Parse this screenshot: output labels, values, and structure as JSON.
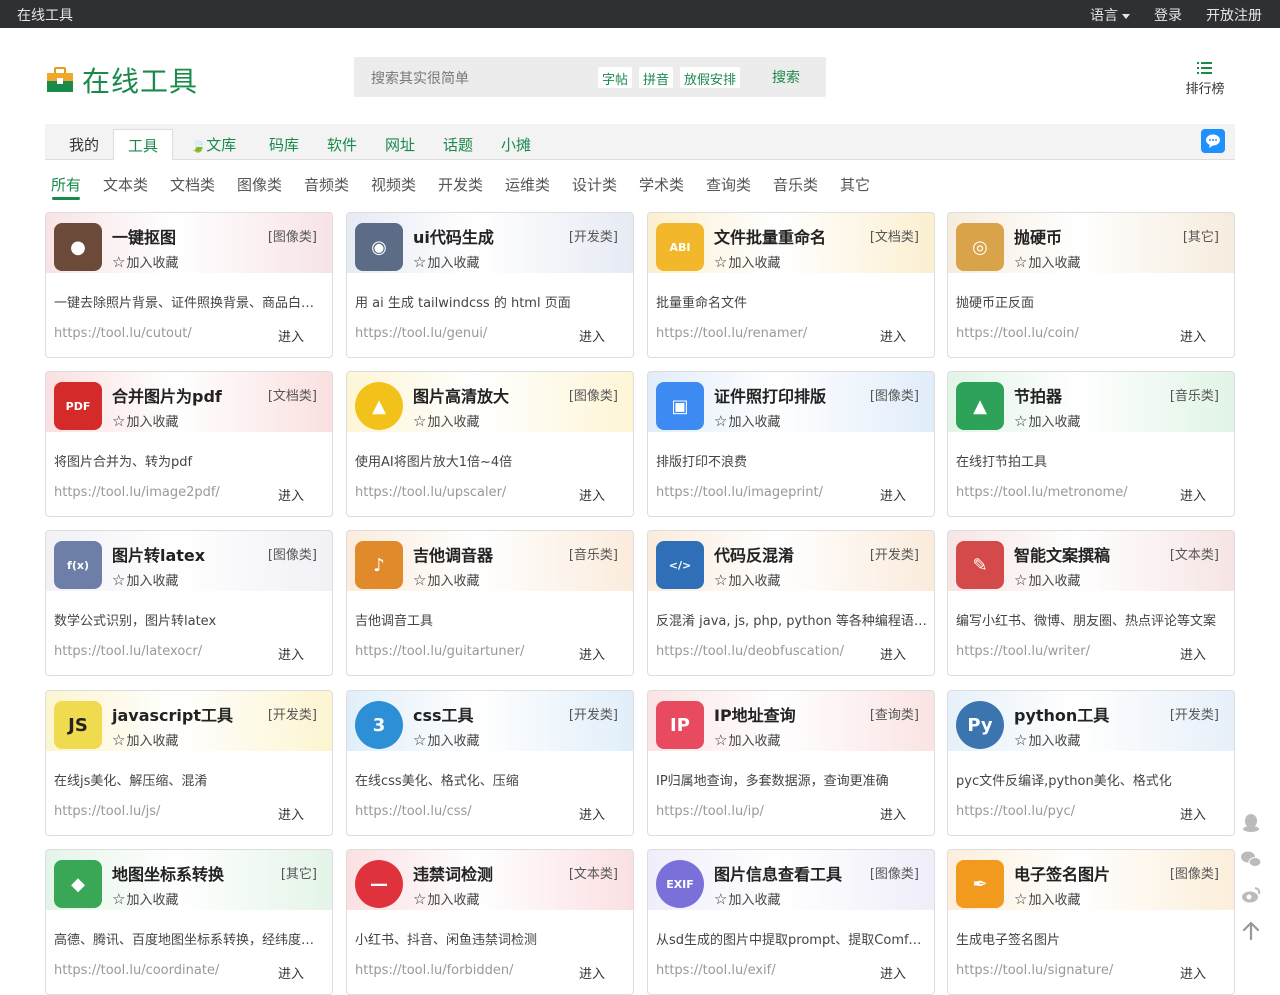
{
  "topbar": {
    "site_name": "在线工具",
    "language": "语言",
    "login": "登录",
    "register": "开放注册"
  },
  "header": {
    "logo_title": "在线工具",
    "search_placeholder": "搜索其实很简单",
    "search_tags": [
      "字帖",
      "拼音",
      "放假安排"
    ],
    "search_button": "搜索",
    "rank_label": "排行榜"
  },
  "main_nav": [
    "我的",
    "工具",
    "文库",
    "码库",
    "软件",
    "网址",
    "话题",
    "小摊"
  ],
  "categories": [
    "所有",
    "文本类",
    "文档类",
    "图像类",
    "音频类",
    "视频类",
    "开发类",
    "运维类",
    "设计类",
    "学术类",
    "查询类",
    "音乐类",
    "其它"
  ],
  "fav_label": "加入收藏",
  "enter_label": "进入",
  "tools": [
    {
      "title": "一键抠图",
      "cat": "[图像类]",
      "desc": "一键去除照片背景、证件照换背景、商品白底图",
      "url": "https://tool.lu/cutout/",
      "icon": "portrait-photo-icon",
      "color": "#e9b0b9"
    },
    {
      "title": "ui代码生成",
      "cat": "[开发类]",
      "desc": "用 ai 生成 tailwindcss 的 html 页面",
      "url": "https://tool.lu/genui/",
      "icon": "robot-cat-icon",
      "color": "#b9c4e0"
    },
    {
      "title": "文件批量重命名",
      "cat": "[文档类]",
      "desc": "批量重命名文件",
      "url": "https://tool.lu/renamer/",
      "icon": "folder-abi-icon",
      "color": "#f4d27a"
    },
    {
      "title": "抛硬币",
      "cat": "[其它]",
      "desc": "抛硬币正反面",
      "url": "https://tool.lu/coin/",
      "icon": "coin-toss-icon",
      "color": "#e6c89e"
    },
    {
      "title": "合并图片为pdf",
      "cat": "[文档类]",
      "desc": "将图片合并为、转为pdf",
      "url": "https://tool.lu/image2pdf/",
      "icon": "pdf-icon",
      "color": "#f2a6a6"
    },
    {
      "title": "图片高清放大",
      "cat": "[图像类]",
      "desc": "使用AI将图片放大1倍~4倍",
      "url": "https://tool.lu/upscaler/",
      "icon": "image-upscale-icon",
      "color": "#f9e38a"
    },
    {
      "title": "证件照打印排版",
      "cat": "[图像类]",
      "desc": "排版打印不浪费",
      "url": "https://tool.lu/imageprint/",
      "icon": "print-layout-icon",
      "color": "#a9c9f2"
    },
    {
      "title": "节拍器",
      "cat": "[音乐类]",
      "desc": "在线打节拍工具",
      "url": "https://tool.lu/metronome/",
      "icon": "metronome-icon",
      "color": "#a8e0b8"
    },
    {
      "title": "图片转latex",
      "cat": "[图像类]",
      "desc": "数学公式识别，图片转latex",
      "url": "https://tool.lu/latexocr/",
      "icon": "formula-icon",
      "color": "#d6d6e6"
    },
    {
      "title": "吉他调音器",
      "cat": "[音乐类]",
      "desc": "吉他调音工具",
      "url": "https://tool.lu/guitartuner/",
      "icon": "guitar-icon",
      "color": "#f3c89c"
    },
    {
      "title": "代码反混淆",
      "cat": "[开发类]",
      "desc": "反混淆 java, js, php, python 等各种编程语言代码",
      "url": "https://tool.lu/deobfuscation/",
      "icon": "puzzle-code-icon",
      "color": "#f2c79a"
    },
    {
      "title": "智能文案撰稿",
      "cat": "[文本类]",
      "desc": "编写小红书、微博、朋友圈、热点评论等文案",
      "url": "https://tool.lu/writer/",
      "icon": "pen-hand-icon",
      "color": "#e8b3b3"
    },
    {
      "title": "javascript工具",
      "cat": "[开发类]",
      "desc": "在线js美化、解压缩、混淆",
      "url": "https://tool.lu/js/",
      "icon": "js-icon",
      "color": "#f7e27a"
    },
    {
      "title": "css工具",
      "cat": "[开发类]",
      "desc": "在线css美化、格式化、压缩",
      "url": "https://tool.lu/css/",
      "icon": "css-icon",
      "color": "#a8cff0"
    },
    {
      "title": "IP地址查询",
      "cat": "[查询类]",
      "desc": "IP归属地查询，多套数据源，查询更准确",
      "url": "https://tool.lu/ip/",
      "icon": "ip-location-icon",
      "color": "#f3b0b0"
    },
    {
      "title": "python工具",
      "cat": "[开发类]",
      "desc": "pyc文件反编译,python美化、格式化",
      "url": "https://tool.lu/pyc/",
      "icon": "python-icon",
      "color": "#b9d3ee"
    },
    {
      "title": "地图坐标系转换",
      "cat": "[其它]",
      "desc": "高德、腾讯、百度地图坐标系转换，经纬度转换",
      "url": "https://tool.lu/coordinate/",
      "icon": "map-pin-icon",
      "color": "#b2e0bd"
    },
    {
      "title": "违禁词检测",
      "cat": "[文本类]",
      "desc": "小红书、抖音、闲鱼违禁词检测",
      "url": "https://tool.lu/forbidden/",
      "icon": "forbidden-icon",
      "color": "#f2a6ad"
    },
    {
      "title": "图片信息查看工具",
      "cat": "[图像类]",
      "desc": "从sd生成的图片中提取prompt、提取ComfyUI工作流",
      "url": "https://tool.lu/exif/",
      "icon": "exif-icon",
      "color": "#d2cdf0"
    },
    {
      "title": "电子签名图片",
      "cat": "[图像类]",
      "desc": "生成电子签名图片",
      "url": "https://tool.lu/signature/",
      "icon": "feather-pen-icon",
      "color": "#f5cf96"
    }
  ],
  "side_tools": [
    "qq-icon",
    "wechat-icon",
    "weibo-icon",
    "back-to-top-icon"
  ]
}
